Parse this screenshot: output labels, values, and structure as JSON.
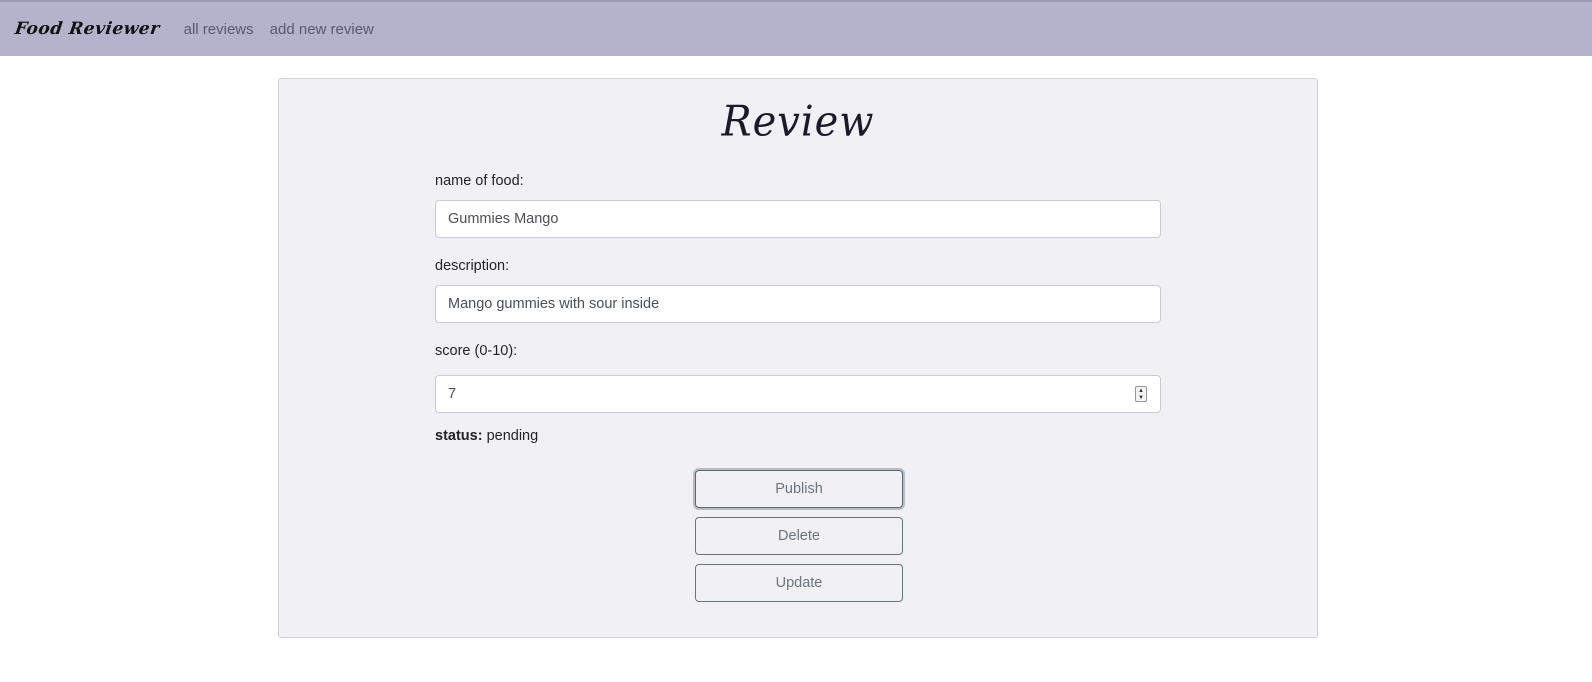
{
  "navbar": {
    "brand": "Food Reviewer",
    "links": [
      {
        "label": "all reviews"
      },
      {
        "label": "add new review"
      }
    ],
    "background_color": "#b3b3cc"
  },
  "review": {
    "title": "Review",
    "name_label": "name of food:",
    "name_value": "Gummies Mango",
    "description_label": "description:",
    "description_value": "Mango gummies with sour inside",
    "score_label": "score (0-10):",
    "score_value": "7",
    "status_key": "status:",
    "status_value": "pending",
    "buttons": {
      "publish": "Publish",
      "delete": "Delete",
      "update": "Update"
    }
  }
}
